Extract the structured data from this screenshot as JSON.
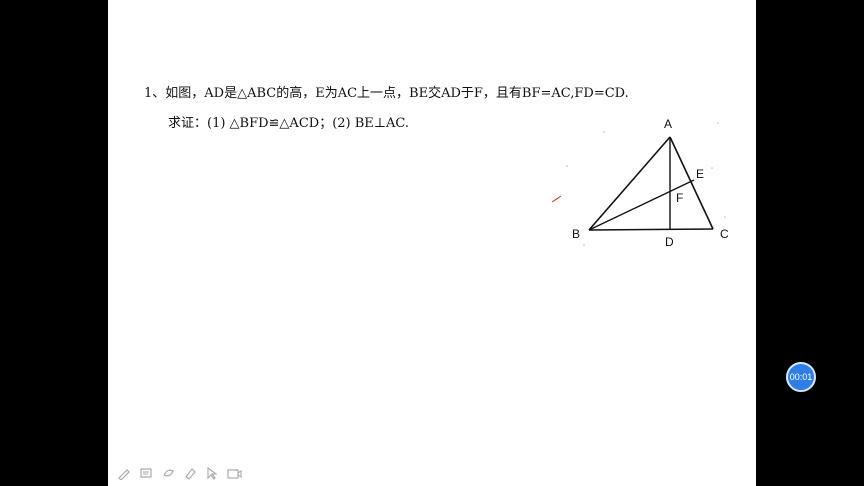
{
  "problem": {
    "line1": "1、如图，AD是△ABC的高，E为AC上一点，BE交AD于F，且有BF=AC,FD=CD.",
    "line2": "求证：(1) △BFD≌△ACD；(2) BE⊥AC."
  },
  "figure": {
    "labels": {
      "A": "A",
      "B": "B",
      "C": "C",
      "D": "D",
      "E": "E",
      "F": "F"
    }
  },
  "timer": {
    "text": "00:01"
  },
  "toolbar": {
    "icons": [
      "pen-icon",
      "board-icon",
      "eraser-icon",
      "highlighter-icon",
      "pointer-icon",
      "camera-icon"
    ]
  }
}
